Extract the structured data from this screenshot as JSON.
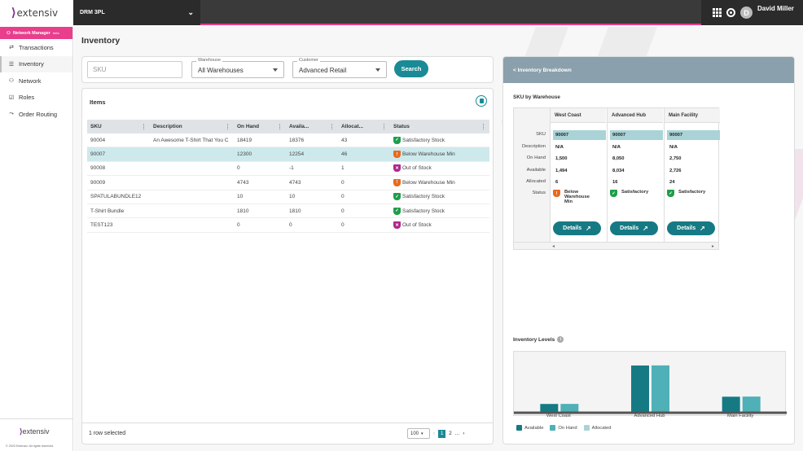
{
  "topbar": {
    "logo_text": "extensiv",
    "org_name": "DRM 3PL",
    "user_initial": "D",
    "user_name": "David Miller"
  },
  "sidebar": {
    "app_badge": "Network Manager",
    "app_badge_tag": "beta",
    "items": [
      {
        "label": "Transactions",
        "icon": "transactions-icon"
      },
      {
        "label": "Inventory",
        "icon": "inventory-icon"
      },
      {
        "label": "Network",
        "icon": "network-icon"
      },
      {
        "label": "Roles",
        "icon": "roles-icon"
      },
      {
        "label": "Order Routing",
        "icon": "routing-icon"
      }
    ],
    "footer_logo": "extensiv",
    "copyright": "© 2023 Extensiv. All rights reserved."
  },
  "page": {
    "title": "Inventory"
  },
  "filters": {
    "sku_placeholder": "SKU",
    "warehouse_label": "Warehouse",
    "warehouse_value": "All Warehouses",
    "customer_label": "Customer",
    "customer_value": "Advanced Retail",
    "search_label": "Search"
  },
  "items": {
    "title": "Items",
    "columns": [
      "SKU",
      "Description",
      "On Hand",
      "Availa...",
      "Allocat...",
      "Status"
    ],
    "rows": [
      {
        "sku": "90004",
        "desc": "An Awesome T-Shirt That You C",
        "on_hand": "18419",
        "avail": "18376",
        "alloc": "43",
        "status": "Satisfactory Stock",
        "status_color": "green"
      },
      {
        "sku": "90007",
        "desc": "",
        "on_hand": "12300",
        "avail": "12254",
        "alloc": "46",
        "status": "Below Warehouse Min",
        "status_color": "orange"
      },
      {
        "sku": "90008",
        "desc": "",
        "on_hand": "0",
        "avail": "-1",
        "alloc": "1",
        "status": "Out of Stock",
        "status_color": "purple"
      },
      {
        "sku": "90009",
        "desc": "",
        "on_hand": "4743",
        "avail": "4743",
        "alloc": "0",
        "status": "Below Warehouse Min",
        "status_color": "orange"
      },
      {
        "sku": "SPATULABUNDLE12",
        "desc": "",
        "on_hand": "10",
        "avail": "10",
        "alloc": "0",
        "status": "Satisfactory Stock",
        "status_color": "green"
      },
      {
        "sku": "T-Shirt Bundle",
        "desc": "",
        "on_hand": "1810",
        "avail": "1810",
        "alloc": "0",
        "status": "Satisfactory Stock",
        "status_color": "green"
      },
      {
        "sku": "TEST123",
        "desc": "",
        "on_hand": "0",
        "avail": "0",
        "alloc": "0",
        "status": "Out of Stock",
        "status_color": "purple"
      }
    ],
    "selected_index": 1,
    "footer_text": "1 row selected",
    "page_size": "100",
    "pages": [
      "1",
      "2",
      "..."
    ],
    "current_page": "1"
  },
  "breakdown": {
    "header": "< Inventory Breakdown",
    "subtitle": "SKU by Warehouse",
    "row_labels": [
      "SKU",
      "Description",
      "On Hand",
      "Available",
      "Allocated",
      "Status"
    ],
    "warehouses": [
      {
        "name": "West Coast",
        "sku": "90007",
        "desc": "N/A",
        "on_hand": "1,500",
        "avail": "1,494",
        "alloc": "6",
        "status": "Below Warehouse Min",
        "status_color": "orange"
      },
      {
        "name": "Advanced Hub",
        "sku": "90007",
        "desc": "N/A",
        "on_hand": "8,050",
        "avail": "8,034",
        "alloc": "16",
        "status": "Satisfactory",
        "status_color": "green"
      },
      {
        "name": "Main Facility",
        "sku": "90007",
        "desc": "N/A",
        "on_hand": "2,750",
        "avail": "2,726",
        "alloc": "24",
        "status": "Satisfactory",
        "status_color": "green"
      }
    ],
    "details_label": "Details",
    "levels_title": "Inventory Levels"
  },
  "chart_data": {
    "type": "bar",
    "categories": [
      "West Coast",
      "Advanced Hub",
      "Main Facility"
    ],
    "series": [
      {
        "name": "Available",
        "values": [
          1494,
          8034,
          2726
        ],
        "color": "#167a84"
      },
      {
        "name": "On Hand",
        "values": [
          1500,
          8050,
          2750
        ],
        "color": "#4fb0b7"
      },
      {
        "name": "Allocated",
        "values": [
          6,
          16,
          24
        ],
        "color": "#a9d3d6"
      }
    ],
    "ylim": [
      0,
      9000
    ],
    "grid": false,
    "legend": "bottom-left"
  },
  "colors": {
    "accent": "#1a8a96",
    "brand": "#e83e8c",
    "header_bar": "#8aa0ac"
  }
}
